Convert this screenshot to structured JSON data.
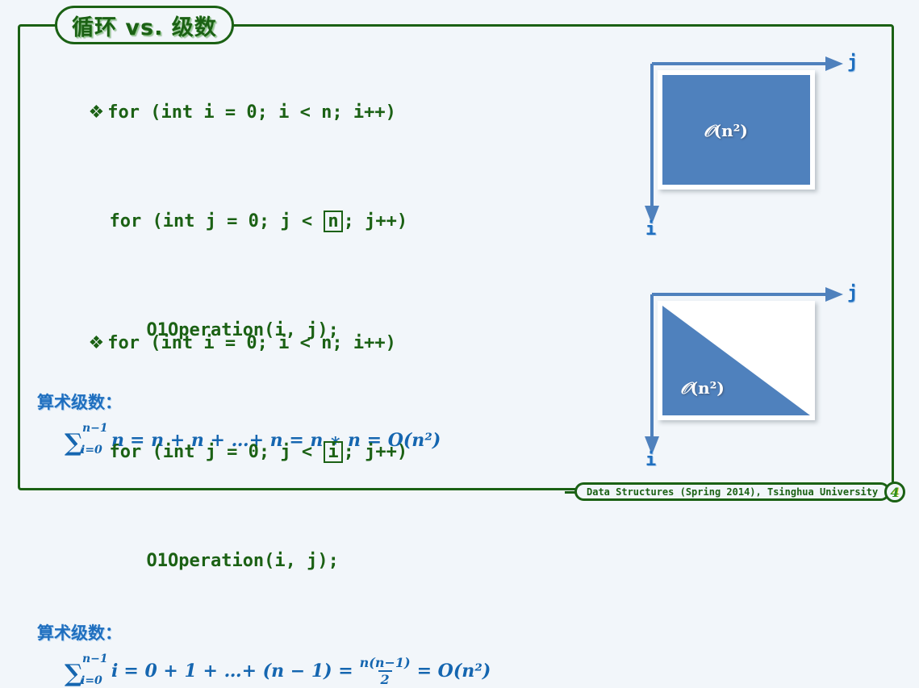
{
  "slide": {
    "title": "循环 vs. 级数",
    "background_color": "#f2f6fa",
    "frame_color": "#1b6114",
    "accent_blue": "#4f81bd",
    "text_blue": "#1f6fbf"
  },
  "blocks": [
    {
      "bullet": "❖",
      "code": [
        {
          "pre": "for (int i = 0; i < n; i++)",
          "boxed": null,
          "post": ""
        },
        {
          "pre": "for (int j = 0; j < ",
          "boxed": "n",
          "post": "; j++)"
        },
        {
          "pre": "O1Operation(i, j);",
          "boxed": null,
          "post": ""
        }
      ],
      "series_label": "算术级数：",
      "formula": {
        "sum_upper": "n−1",
        "sum_lower": "i=0",
        "sum_body": "n",
        "expansion": "= n + n +  …+ n = n ∗ n = O(n²)",
        "plain": "∑(i=0..n−1) n = n + n + … + n = n * n = O(n²)"
      }
    },
    {
      "bullet": "❖",
      "code": [
        {
          "pre": "for (int i = 0; i < n; i++)",
          "boxed": null,
          "post": ""
        },
        {
          "pre": "for (int j = 0; j < ",
          "boxed": "i",
          "post": "; j++)"
        },
        {
          "pre": "O1Operation(i, j);",
          "boxed": null,
          "post": ""
        }
      ],
      "series_label": "算术级数：",
      "formula": {
        "sum_upper": "n−1",
        "sum_lower": "i=0",
        "sum_body": "i",
        "expansion_head": "= 0 + 1 +  …+ (n − 1) =",
        "fraction_numerator": "n(n−1)",
        "fraction_denominator": "2",
        "expansion_tail": "= O(n²)",
        "plain": "∑(i=0..n−1) i = 0 + 1 + … + (n−1) = n(n−1)/2 = O(n²)"
      }
    }
  ],
  "diagrams": [
    {
      "shape": "square",
      "label_prefix": "𝒪",
      "label_body": "(n²)",
      "axis_horizontal": "j",
      "axis_vertical": "i"
    },
    {
      "shape": "triangle",
      "label_prefix": "𝒪",
      "label_body": "(n²)",
      "axis_horizontal": "j",
      "axis_vertical": "i"
    }
  ],
  "footer": {
    "text": "Data Structures (Spring 2014), Tsinghua University",
    "page_number": "4"
  }
}
